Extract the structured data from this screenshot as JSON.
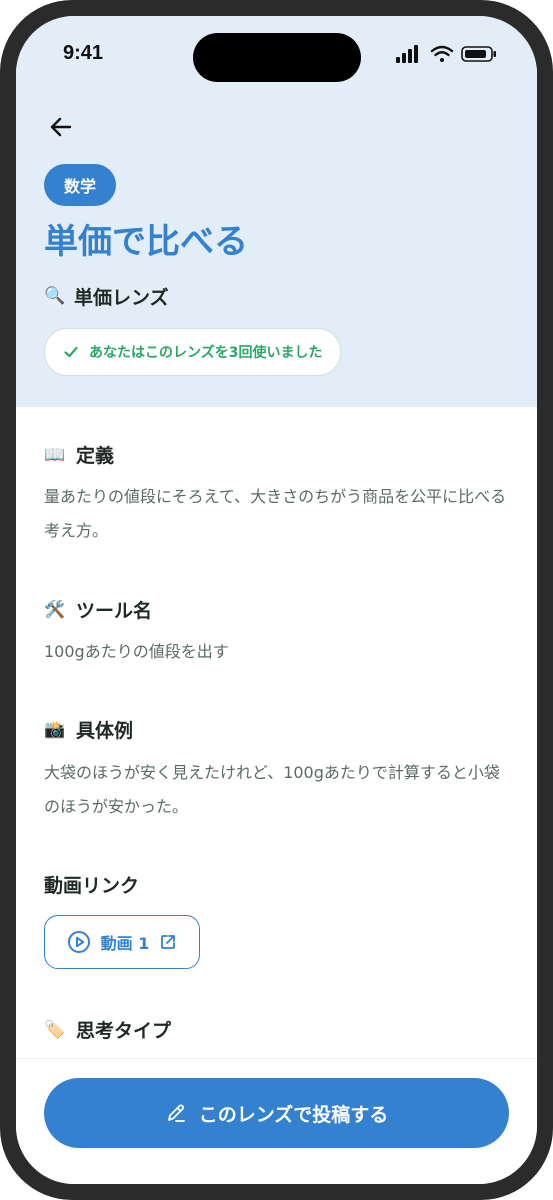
{
  "status": {
    "time": "9:41"
  },
  "header": {
    "subject_badge": "数学",
    "title": "単価で比べる",
    "lens_emoji": "🔍",
    "lens_name": "単価レンズ",
    "usage_text": "あなたはこのレンズを3回使いました"
  },
  "sections": {
    "definition": {
      "emoji": "📖",
      "title": "定義",
      "text": "量あたりの値段にそろえて、大きさのちがう商品を公平に比べる考え方。"
    },
    "tool": {
      "emoji": "🛠️",
      "title": "ツール名",
      "text": "100gあたりの値段を出す"
    },
    "example": {
      "emoji": "📸",
      "title": "具体例",
      "text": "大袋のほうが安く見えたけれど、100gあたりで計算すると小袋のほうが安かった。"
    },
    "videos": {
      "title": "動画リンク",
      "items": [
        {
          "label": "動画 1"
        }
      ]
    },
    "thinking": {
      "emoji": "🏷️",
      "title": "思考タイプ"
    }
  },
  "cta": {
    "label": "このレンズで投稿する"
  },
  "colors": {
    "accent": "#3381cf",
    "success": "#2aa866",
    "hero_bg": "#e2edf8"
  },
  "icons": {
    "back": "arrow-left-icon",
    "check": "check-icon",
    "play": "play-circle-icon",
    "external": "external-link-icon",
    "pencil": "pencil-icon"
  }
}
